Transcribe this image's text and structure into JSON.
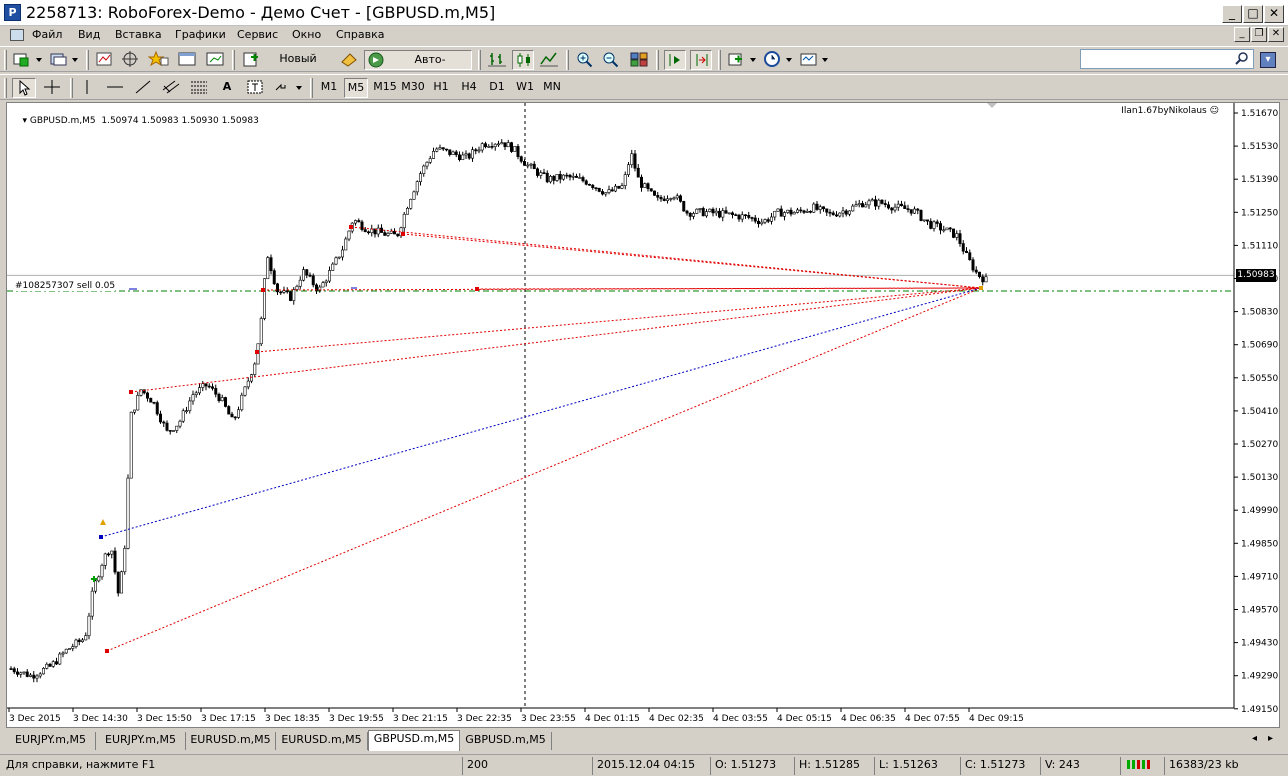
{
  "window": {
    "title": "2258713: RoboForex-Demo - Демо Счет - [GBPUSD.m,M5]",
    "minimize": "_",
    "maximize": "□",
    "close": "✕"
  },
  "menu": [
    "Файл",
    "Вид",
    "Вставка",
    "Графики",
    "Сервис",
    "Окно",
    "Справка"
  ],
  "toolbar": {
    "new_order": "Новый ордер",
    "auto_trading": "Авто-торговля",
    "timeframes": [
      "M1",
      "M5",
      "M15",
      "M30",
      "H1",
      "H4",
      "D1",
      "W1",
      "MN"
    ],
    "active_timeframe": "M5",
    "text_tool": "A"
  },
  "search": {
    "placeholder": ""
  },
  "chart": {
    "header": "GBPUSD.m,M5  1.50974 1.50983 1.50930 1.50983",
    "expert": "Ilan1.67byNikolaus",
    "order_label": "#108257307 sell 0.05",
    "current_price": "1.50983",
    "price_labels": [
      "1.51670",
      "1.51530",
      "1.51390",
      "1.51250",
      "1.51110",
      "1.50970",
      "1.50830",
      "1.50690",
      "1.50550",
      "1.50410",
      "1.50270",
      "1.50130",
      "1.49990",
      "1.49850",
      "1.49710",
      "1.49570",
      "1.49430",
      "1.49290",
      "1.49150"
    ],
    "time_labels": [
      "3 Dec 2015",
      "3 Dec 14:30",
      "3 Dec 15:50",
      "3 Dec 17:15",
      "3 Dec 18:35",
      "3 Dec 19:55",
      "3 Dec 21:15",
      "3 Dec 22:35",
      "3 Dec 23:55",
      "4 Dec 01:15",
      "4 Dec 02:35",
      "4 Dec 03:55",
      "4 Dec 05:15",
      "4 Dec 06:35",
      "4 Dec 07:55",
      "4 Dec 09:15"
    ],
    "colors": {
      "bull": "#ffffff",
      "bear": "#000000",
      "sell_line": "#e00000",
      "buy_line": "#0000c0",
      "tp_line": "#008000"
    }
  },
  "tabs": [
    "EURJPY.m,M5",
    "EURJPY.m,M5",
    "EURUSD.m,M5",
    "EURUSD.m,M5",
    "GBPUSD.m,M5",
    "GBPUSD.m,M5"
  ],
  "active_tab": 4,
  "status": {
    "help": "Для справки, нажмите F1",
    "profile": "200",
    "datetime": "2015.12.04 04:15",
    "open": "O: 1.51273",
    "high": "H: 1.51285",
    "low": "L: 1.51263",
    "close": "C: 1.51273",
    "volume": "V: 243",
    "traffic": "16383/23 kb"
  }
}
